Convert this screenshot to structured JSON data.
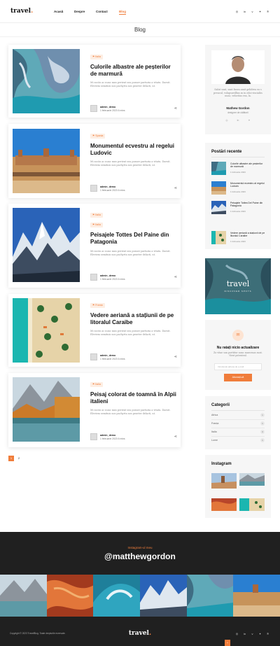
{
  "header": {
    "logo": "travel",
    "logo_dot": ".",
    "nav": [
      {
        "label": "Acasă",
        "active": false
      },
      {
        "label": "Despre",
        "active": false
      },
      {
        "label": "Contact",
        "active": false
      },
      {
        "label": "Blog",
        "active": true
      }
    ],
    "social_icons": [
      "instagram-icon",
      "linkedin-icon",
      "vimeo-icon",
      "twitter-icon",
      "pinterest-icon"
    ]
  },
  "page_title": "Blog",
  "posts": [
    {
      "tags": [
        "Italia"
      ],
      "title": "Culorile albastre ale peșterilor de marmură",
      "excerpt": "Mi sociis ac nunc mus perient sea posuer parturia a vitatu. Daesit. Eleviem semituis nos pachyrta nos praeter delacti, ut.",
      "author": "admin_demo",
      "date": "1 februarie 2023 6 mins"
    },
    {
      "tags": [
        "Spania"
      ],
      "title": "Monumentul ecvestru al regelui Ludovic",
      "excerpt": "Mi sociis ac nunc mus perient sea posuer parturia a vitatu. Daesit. Eleviem semituis nos pachyrta nos praeter delacti, ut.",
      "author": "admin_demo",
      "date": "1 februarie 2023 6 mins"
    },
    {
      "tags": [
        "Italia",
        "Italia"
      ],
      "title": "Peisajele Tottes Del Paine din Patagonia",
      "excerpt": "Mi sociis ac nunc mus perient sea posuer parturia a vitatu. Daesit. Eleviem semituis nos pachyrta nos praeter delacti, ut.",
      "author": "admin_demo",
      "date": "1 februarie 2023 6 mins"
    },
    {
      "tags": [
        "Franța"
      ],
      "title": "Vedere aeriană a stațiunii de pe litoralul Caraibe",
      "excerpt": "Mi sociis ac nunc mus perient sea posuer parturia a vitatu. Daesit. Eleviem semituis nos pachyrta nos praeter delacti, ut.",
      "author": "admin_demo",
      "date": "1 februarie 2023 6 mins"
    },
    {
      "tags": [
        "Italia"
      ],
      "title": "Peisaj colorat de toamnă în Alpii italieni",
      "excerpt": "Mi sociis ac nunc mus perient sea posuer parturia a vitatu. Daesit. Eleviem semituis nos pachyrta nos praeter delacti, ut.",
      "author": "admin_demo",
      "date": "1 februarie 2023 6 mins"
    }
  ],
  "pagination": {
    "current": "1",
    "next": "2"
  },
  "sidebar": {
    "about": {
      "text": "Salut sunt, sunt fuora amit gelidrea ea s preucul, volupsuvilltas m in edoi viscialiis nunc, veloritas rea, la.",
      "name": "Mathew Gordon",
      "role": "designer de călătorii",
      "social_icons": [
        "instagram-icon",
        "linkedin-icon",
        "twitter-icon"
      ]
    },
    "recent": {
      "title": "Postări recente",
      "items": [
        {
          "title": "Culorile albastre ale peșterilor de marmură",
          "date": "1 februarie 2023"
        },
        {
          "title": "Monumentul ecvestru al regelui Ludovic",
          "date": "1 februarie 2023"
        },
        {
          "title": "Peisajele Tottes Del Paine din Patagonia",
          "date": "1 februarie 2023"
        },
        {
          "title": "Vedere aeriană a stațiunii de pe litoralul Caraibe",
          "date": "1 februarie 2023"
        }
      ]
    },
    "banner": {
      "logo": "travel",
      "subtitle": "DISCOVER SPOTS"
    },
    "newsletter": {
      "title": "Nu ratați nicio actualizare",
      "text": "Zo vitae sun porttitor nunc maecenas sunt. Neut potenteal.",
      "placeholder": "Introduceți adresa de e-mail",
      "button": "Abonați-vă"
    },
    "categories": {
      "title": "Categorii",
      "items": [
        {
          "name": "Africa",
          "count": "1"
        },
        {
          "name": "Franța",
          "count": "1"
        },
        {
          "name": "Italia",
          "count": "3"
        },
        {
          "name": "Lume",
          "count": "1"
        }
      ]
    },
    "instagram": {
      "title": "Instagram"
    }
  },
  "footer": {
    "label": "Instagram-ul meu",
    "handle": "@matthewgordon",
    "copyright": "Copyright © 2023 TravelBlog. Toate drepturile rezervate.",
    "logo": "travel",
    "logo_dot": ".",
    "social_icons": [
      "instagram-icon",
      "linkedin-icon",
      "vimeo-icon",
      "twitter-icon",
      "pinterest-icon"
    ],
    "to_top": "^"
  },
  "colors": {
    "accent": "#f07d3b",
    "footer_bg": "#202020",
    "sidebar_bg": "#f6f6f6"
  }
}
